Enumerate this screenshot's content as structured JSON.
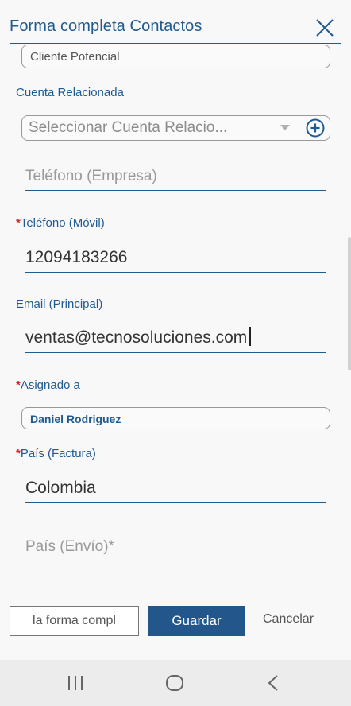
{
  "header": {
    "title": "Forma completa Contactos",
    "close_icon": "close-icon"
  },
  "fields": {
    "lead_type": {
      "value": "Cliente Potencial"
    },
    "related_account": {
      "label": "Cuenta Relacionada",
      "placeholder": "Seleccionar Cuenta Relacio...",
      "add_icon": "plus-circle-icon"
    },
    "company_phone": {
      "placeholder": "Teléfono (Empresa)"
    },
    "mobile_phone": {
      "required": "*",
      "label": "Teléfono (Móvil)",
      "value": "12094183266"
    },
    "email": {
      "label": "Email (Principal)",
      "value": "ventas@tecnosoluciones.com"
    },
    "assigned_to": {
      "required": "*",
      "label": "Asignado a",
      "value": "Daniel Rodriguez"
    },
    "billing_country": {
      "required": "*",
      "label": "País (Factura)",
      "value": "Colombia"
    },
    "shipping_country": {
      "placeholder": "País (Envío)*"
    }
  },
  "footer": {
    "full_form_label": "la forma compl",
    "save_label": "Guardar",
    "cancel_label": "Cancelar"
  },
  "colors": {
    "accent": "#1f5a91",
    "primary_button": "#23578c",
    "required": "#d0262c"
  },
  "navbar": {
    "icons": [
      "recent-apps-icon",
      "home-icon",
      "back-icon"
    ]
  }
}
